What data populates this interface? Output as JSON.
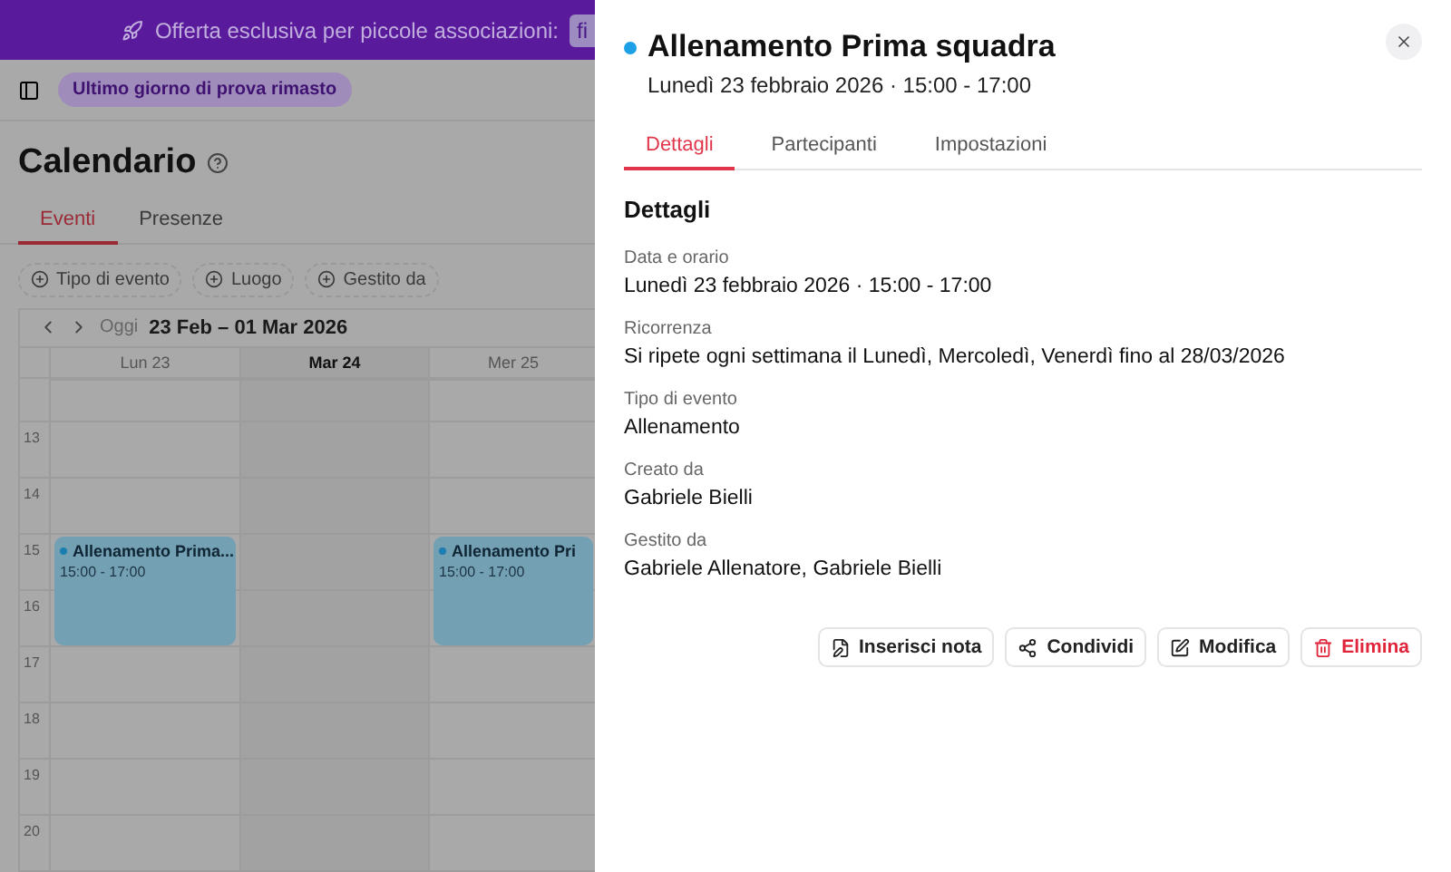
{
  "banner": {
    "text": "Offerta esclusiva per piccole associazioni:",
    "chip": "fi"
  },
  "topbar": {
    "trial_badge": "Ultimo giorno di prova rimasto"
  },
  "page": {
    "title": "Calendario",
    "tabs": [
      {
        "label": "Eventi",
        "selected": true
      },
      {
        "label": "Presenze",
        "selected": false
      }
    ],
    "filters": [
      "Tipo di evento",
      "Luogo",
      "Gestito da"
    ],
    "nav": {
      "today": "Oggi",
      "range": "23 Feb – 01 Mar 2026"
    },
    "hours": [
      "13",
      "14",
      "15",
      "16",
      "17",
      "18",
      "19",
      "20"
    ],
    "days": [
      {
        "label": "Lun 23",
        "selected": false,
        "events": [
          {
            "title": "Allenamento Prima...",
            "time": "15:00 - 17:00",
            "color": "#1a7eb0"
          }
        ]
      },
      {
        "label": "Mar 24",
        "selected": true
      },
      {
        "label": "Mer 25",
        "selected": false,
        "events": [
          {
            "title": "Allenamento Pri",
            "time": "15:00 - 17:00",
            "color": "#1a7eb0"
          }
        ]
      }
    ]
  },
  "panel": {
    "title": "Allenamento Prima squadra",
    "color": "#1ea0e6",
    "subtitle": "Lunedì 23 febbraio 2026 · 15:00 - 17:00",
    "tabs": [
      {
        "label": "Dettagli",
        "selected": true
      },
      {
        "label": "Partecipanti",
        "selected": false
      },
      {
        "label": "Impostazioni",
        "selected": false
      }
    ],
    "section_title": "Dettagli",
    "fields": [
      {
        "label": "Data e orario",
        "value": "Lunedì 23 febbraio 2026 · 15:00 - 17:00"
      },
      {
        "label": "Ricorrenza",
        "value": "Si ripete ogni settimana il Lunedì, Mercoledì, Venerdì fino al 28/03/2026"
      },
      {
        "label": "Tipo di evento",
        "value": "Allenamento"
      },
      {
        "label": "Creato da",
        "value": "Gabriele Bielli"
      },
      {
        "label": "Gestito da",
        "value": "Gabriele Allenatore, Gabriele Bielli"
      }
    ],
    "actions": [
      {
        "kind": "note",
        "label": "Inserisci nota"
      },
      {
        "kind": "share",
        "label": "Condividi"
      },
      {
        "kind": "edit",
        "label": "Modifica"
      },
      {
        "kind": "delete",
        "label": "Elimina"
      }
    ]
  }
}
